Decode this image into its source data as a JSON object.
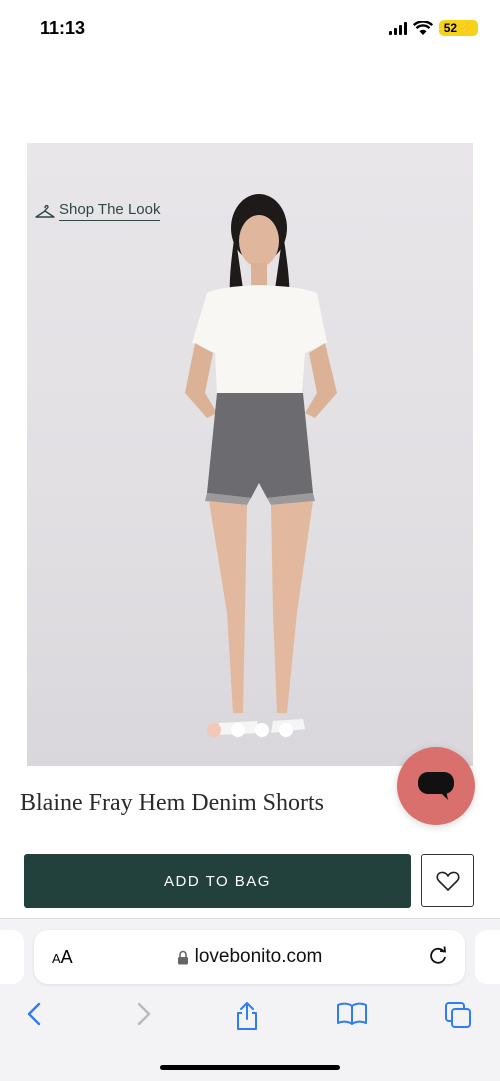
{
  "status": {
    "time": "11:13",
    "battery": "52"
  },
  "hero": {
    "shop_the_look": "Shop The Look",
    "carousel": {
      "count": 4,
      "active_index": 0
    }
  },
  "product": {
    "title": "Blaine Fray Hem Denim Shorts"
  },
  "actions": {
    "add_to_bag": "ADD TO BAG"
  },
  "browser": {
    "text_size_label_small": "A",
    "text_size_label_large": "A",
    "url": "lovebonito.com"
  },
  "colors": {
    "brand_green": "#22403c",
    "chat_button": "#d9706e",
    "active_dot": "#f3c8b6"
  },
  "icons": [
    "hanger-icon",
    "chat-icon",
    "heart-icon",
    "lock-icon",
    "reload-icon",
    "back-icon",
    "forward-icon",
    "share-icon",
    "bookmarks-icon",
    "tabs-icon"
  ]
}
